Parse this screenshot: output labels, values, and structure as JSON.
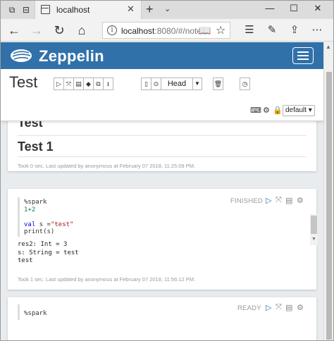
{
  "browser": {
    "tab_title": "localhost",
    "tab_close": "✕",
    "new_tab": "+",
    "tab_menu": "⌄",
    "window": {
      "minimize": "—",
      "maximize": "☐",
      "close": "✕"
    },
    "address": {
      "host": "localhost",
      "path": ":8080/#/note"
    },
    "nav": {
      "back": "←",
      "forward": "→",
      "refresh": "↻",
      "home": "⌂"
    },
    "icons": [
      "tab-aside-icon",
      "tab-preview-icon",
      "reading-view-icon",
      "favorite-star-icon",
      "favorites-hub-icon",
      "pen-icon",
      "share-icon",
      "more-icon"
    ]
  },
  "app": {
    "brand": "Zeppelin",
    "colors": {
      "navbar": "#3071a9",
      "accent": "#3071a9"
    }
  },
  "note": {
    "title": "Test",
    "head_label": "Head",
    "interpreter": "default"
  },
  "paragraphs": [
    {
      "heading_cut": "Test",
      "heading": "Test 1",
      "footer": "Took 0 sec. Last updated by anonymous at February 07 2018, 11:25:09 PM."
    },
    {
      "status": "FINISHED",
      "code": {
        "line1": "%spark",
        "line2": "1+2",
        "line4_kw": "val",
        "line4_rest": " s =",
        "line4_str": "\"test\"",
        "line5": "print(s)"
      },
      "output": [
        "res2: Int = 3",
        "s: String = test",
        "test"
      ],
      "footer": "Took 1 sec. Last updated by anonymous at February 07 2018, 11:56:12 PM."
    },
    {
      "status": "READY",
      "code": {
        "line1": "%spark"
      }
    }
  ]
}
